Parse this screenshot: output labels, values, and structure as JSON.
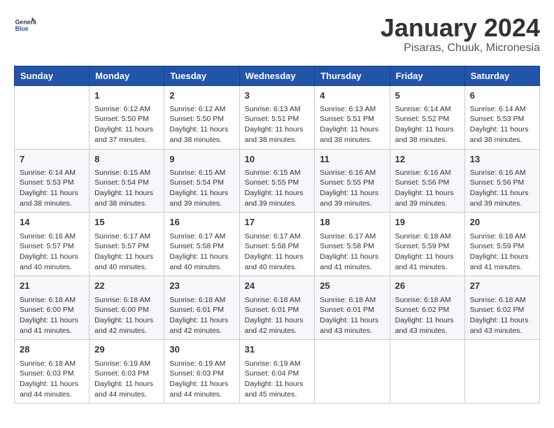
{
  "header": {
    "logo_general": "General",
    "logo_blue": "Blue",
    "title": "January 2024",
    "subtitle": "Pisaras, Chuuk, Micronesia"
  },
  "calendar": {
    "days_of_week": [
      "Sunday",
      "Monday",
      "Tuesday",
      "Wednesday",
      "Thursday",
      "Friday",
      "Saturday"
    ],
    "weeks": [
      [
        {
          "day": "",
          "info": ""
        },
        {
          "day": "1",
          "info": "Sunrise: 6:12 AM\nSunset: 5:50 PM\nDaylight: 11 hours\nand 37 minutes."
        },
        {
          "day": "2",
          "info": "Sunrise: 6:12 AM\nSunset: 5:50 PM\nDaylight: 11 hours\nand 38 minutes."
        },
        {
          "day": "3",
          "info": "Sunrise: 6:13 AM\nSunset: 5:51 PM\nDaylight: 11 hours\nand 38 minutes."
        },
        {
          "day": "4",
          "info": "Sunrise: 6:13 AM\nSunset: 5:51 PM\nDaylight: 11 hours\nand 38 minutes."
        },
        {
          "day": "5",
          "info": "Sunrise: 6:14 AM\nSunset: 5:52 PM\nDaylight: 11 hours\nand 38 minutes."
        },
        {
          "day": "6",
          "info": "Sunrise: 6:14 AM\nSunset: 5:53 PM\nDaylight: 11 hours\nand 38 minutes."
        }
      ],
      [
        {
          "day": "7",
          "info": "Sunrise: 6:14 AM\nSunset: 5:53 PM\nDaylight: 11 hours\nand 38 minutes."
        },
        {
          "day": "8",
          "info": "Sunrise: 6:15 AM\nSunset: 5:54 PM\nDaylight: 11 hours\nand 38 minutes."
        },
        {
          "day": "9",
          "info": "Sunrise: 6:15 AM\nSunset: 5:54 PM\nDaylight: 11 hours\nand 39 minutes."
        },
        {
          "day": "10",
          "info": "Sunrise: 6:15 AM\nSunset: 5:55 PM\nDaylight: 11 hours\nand 39 minutes."
        },
        {
          "day": "11",
          "info": "Sunrise: 6:16 AM\nSunset: 5:55 PM\nDaylight: 11 hours\nand 39 minutes."
        },
        {
          "day": "12",
          "info": "Sunrise: 6:16 AM\nSunset: 5:56 PM\nDaylight: 11 hours\nand 39 minutes."
        },
        {
          "day": "13",
          "info": "Sunrise: 6:16 AM\nSunset: 5:56 PM\nDaylight: 11 hours\nand 39 minutes."
        }
      ],
      [
        {
          "day": "14",
          "info": "Sunrise: 6:16 AM\nSunset: 5:57 PM\nDaylight: 11 hours\nand 40 minutes."
        },
        {
          "day": "15",
          "info": "Sunrise: 6:17 AM\nSunset: 5:57 PM\nDaylight: 11 hours\nand 40 minutes."
        },
        {
          "day": "16",
          "info": "Sunrise: 6:17 AM\nSunset: 5:58 PM\nDaylight: 11 hours\nand 40 minutes."
        },
        {
          "day": "17",
          "info": "Sunrise: 6:17 AM\nSunset: 5:58 PM\nDaylight: 11 hours\nand 40 minutes."
        },
        {
          "day": "18",
          "info": "Sunrise: 6:17 AM\nSunset: 5:58 PM\nDaylight: 11 hours\nand 41 minutes."
        },
        {
          "day": "19",
          "info": "Sunrise: 6:18 AM\nSunset: 5:59 PM\nDaylight: 11 hours\nand 41 minutes."
        },
        {
          "day": "20",
          "info": "Sunrise: 6:18 AM\nSunset: 5:59 PM\nDaylight: 11 hours\nand 41 minutes."
        }
      ],
      [
        {
          "day": "21",
          "info": "Sunrise: 6:18 AM\nSunset: 6:00 PM\nDaylight: 11 hours\nand 41 minutes."
        },
        {
          "day": "22",
          "info": "Sunrise: 6:18 AM\nSunset: 6:00 PM\nDaylight: 11 hours\nand 42 minutes."
        },
        {
          "day": "23",
          "info": "Sunrise: 6:18 AM\nSunset: 6:01 PM\nDaylight: 11 hours\nand 42 minutes."
        },
        {
          "day": "24",
          "info": "Sunrise: 6:18 AM\nSunset: 6:01 PM\nDaylight: 11 hours\nand 42 minutes."
        },
        {
          "day": "25",
          "info": "Sunrise: 6:18 AM\nSunset: 6:01 PM\nDaylight: 11 hours\nand 43 minutes."
        },
        {
          "day": "26",
          "info": "Sunrise: 6:18 AM\nSunset: 6:02 PM\nDaylight: 11 hours\nand 43 minutes."
        },
        {
          "day": "27",
          "info": "Sunrise: 6:18 AM\nSunset: 6:02 PM\nDaylight: 11 hours\nand 43 minutes."
        }
      ],
      [
        {
          "day": "28",
          "info": "Sunrise: 6:18 AM\nSunset: 6:03 PM\nDaylight: 11 hours\nand 44 minutes."
        },
        {
          "day": "29",
          "info": "Sunrise: 6:19 AM\nSunset: 6:03 PM\nDaylight: 11 hours\nand 44 minutes."
        },
        {
          "day": "30",
          "info": "Sunrise: 6:19 AM\nSunset: 6:03 PM\nDaylight: 11 hours\nand 44 minutes."
        },
        {
          "day": "31",
          "info": "Sunrise: 6:19 AM\nSunset: 6:04 PM\nDaylight: 11 hours\nand 45 minutes."
        },
        {
          "day": "",
          "info": ""
        },
        {
          "day": "",
          "info": ""
        },
        {
          "day": "",
          "info": ""
        }
      ]
    ]
  }
}
